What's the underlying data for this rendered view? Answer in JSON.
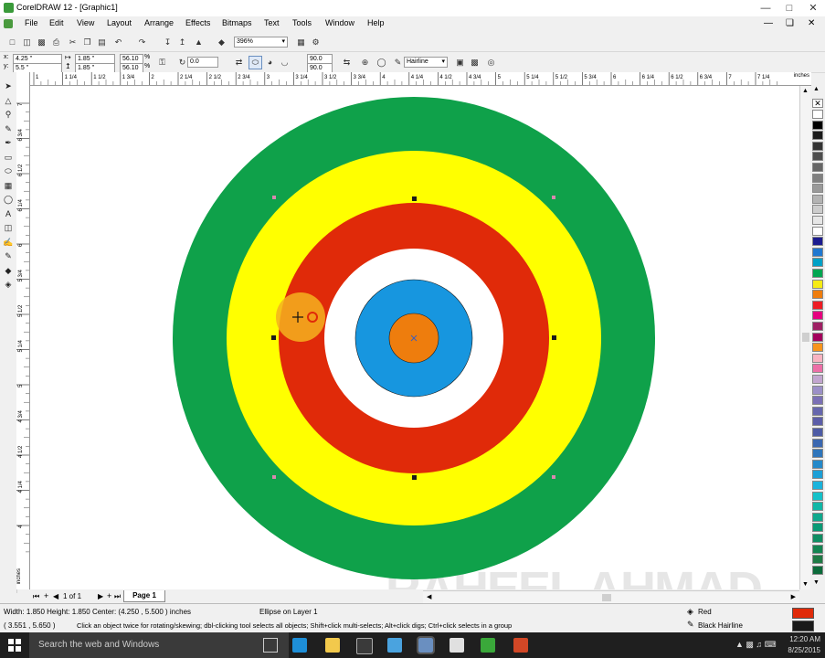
{
  "window": {
    "title": "CorelDRAW 12 - [Graphic1]"
  },
  "menu": [
    "File",
    "Edit",
    "View",
    "Layout",
    "Arrange",
    "Effects",
    "Bitmaps",
    "Text",
    "Tools",
    "Window",
    "Help"
  ],
  "toolbar": {
    "zoom": "396%"
  },
  "propbar": {
    "x": "4.25 \"",
    "y": "5.5 \"",
    "w": "1.85 \"",
    "h": "1.85 \"",
    "sx": "56.10",
    "sy": "56.10",
    "rotation": "0.0",
    "start_angle": "90.0",
    "end_angle": "90.0",
    "outline": "Hairline",
    "pct_sign": "%"
  },
  "ruler": {
    "h_labels": [
      "1",
      "1 1/4",
      "1 1/2",
      "1 3/4",
      "2",
      "2 1/4",
      "2 1/2",
      "2 3/4",
      "3",
      "3 1/4",
      "3 1/2",
      "3 3/4",
      "4",
      "4 1/4",
      "4 1/2",
      "4 3/4",
      "5",
      "5 1/4",
      "5 1/2",
      "5 3/4",
      "6",
      "6 1/4",
      "6 1/2",
      "6 3/4",
      "7",
      "7 1/4"
    ],
    "units": "inches",
    "v_labels": [
      "7",
      "6 3/4",
      "6 1/2",
      "6 1/4",
      "6",
      "5 3/4",
      "5 1/2",
      "5 1/4",
      "5",
      "4 3/4",
      "4 1/2",
      "4 1/4",
      "4"
    ],
    "v_units": "inches"
  },
  "target": {
    "rings": [
      {
        "name": "green",
        "color": "#0fa14a"
      },
      {
        "name": "yellow",
        "color": "#ffff00"
      },
      {
        "name": "red",
        "color": "#e02a09"
      },
      {
        "name": "white",
        "color": "#ffffff"
      },
      {
        "name": "blue",
        "color": "#1796df"
      },
      {
        "name": "orange",
        "color": "#ee7d0d"
      }
    ]
  },
  "pages": {
    "counter": "1 of 1",
    "tab": "Page 1"
  },
  "status": {
    "dims": "Width: 1.850  Height: 1.850  Center: (4.250 , 5.500 )  inches",
    "object": "Ellipse on Layer 1",
    "coords": "( 3.551 , 5.650  )",
    "hint": "Click an object twice for rotating/skewing; dbl-clicking tool selects all objects; Shift+click multi-selects; Alt+click digs; Ctrl+click selects in a group",
    "fill_label": "Red",
    "fill_color": "#e02a09",
    "outline_label": "Black  Hairline",
    "outline_color": "#1a1a1a"
  },
  "taskbar": {
    "search_placeholder": "Search the web and Windows",
    "time": "12:20 AM",
    "date": "8/25/2015"
  },
  "watermark": "RAHEEL AHMAD",
  "palette": [
    "#ffffff",
    "#000000",
    "#1a1a1a",
    "#333333",
    "#4d4d4d",
    "#666666",
    "#808080",
    "#999999",
    "#b3b3b3",
    "#cccccc",
    "#e6e6e6",
    "#ffffff",
    "#1b1b8f",
    "#1f77d0",
    "#00a0c6",
    "#00a651",
    "#f6eb14",
    "#ee7d0d",
    "#ed1c24",
    "#e6007e",
    "#9e1f63",
    "#a3005c",
    "#f7941d",
    "#f9b3c1",
    "#ed6ea7",
    "#c2a5cf",
    "#9b8fc7",
    "#7a6fb5",
    "#6566ad",
    "#5b5da8",
    "#4d5ba5",
    "#3a67b0",
    "#2e75bb",
    "#2389c9",
    "#1c9fd6",
    "#19b3dc",
    "#13c1c9",
    "#10b7a6",
    "#0fa88c",
    "#0a9a75",
    "#0f8e63",
    "#138451",
    "#1e7a45",
    "#0b6a3a"
  ]
}
